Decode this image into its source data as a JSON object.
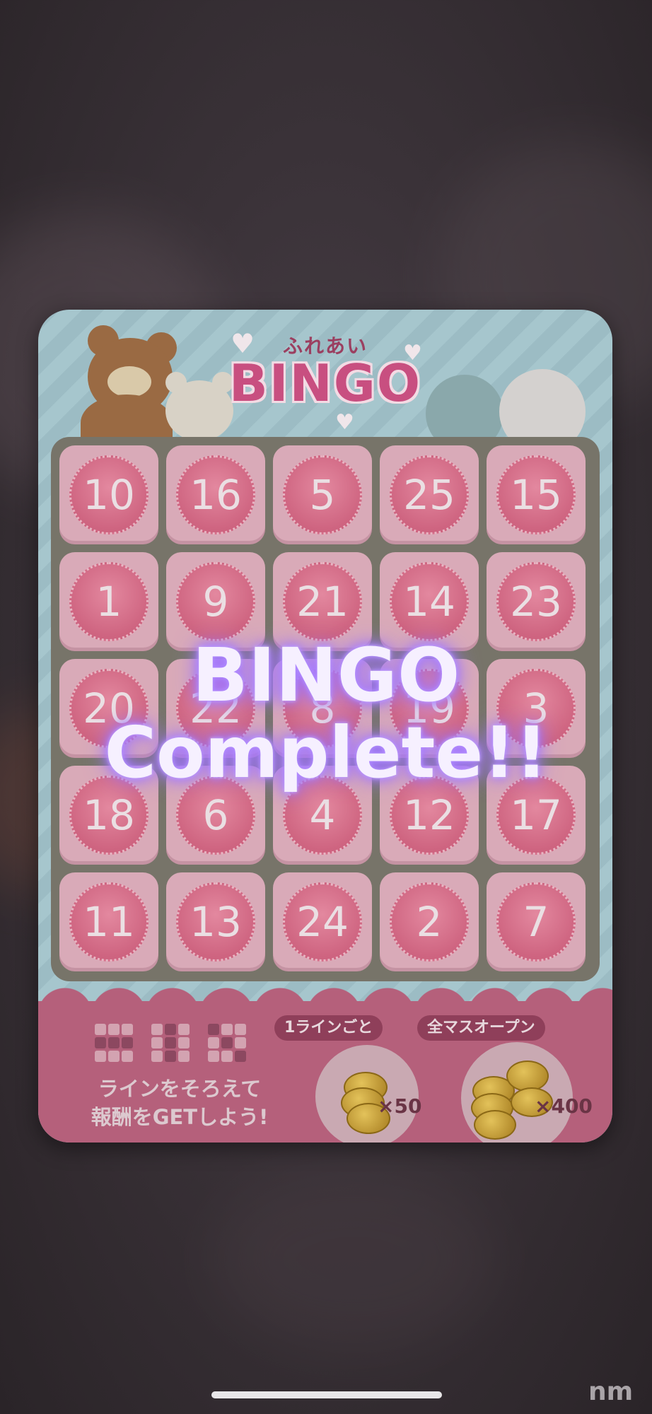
{
  "colors": {
    "backdrop": "#3a3238",
    "card_stripe": "#9cbcc4",
    "cell_bg": "#d9aab8",
    "stamp_pink": "#cf6581",
    "footer": "#b5607b",
    "overlay_glow": "#a27aff"
  },
  "header": {
    "subtitle": "ふれあい",
    "title": "BINGO"
  },
  "board": {
    "rows": [
      [
        "10",
        "16",
        "5",
        "25",
        "15"
      ],
      [
        "1",
        "9",
        "21",
        "14",
        "23"
      ],
      [
        "20",
        "22",
        "8",
        "19",
        "3"
      ],
      [
        "18",
        "6",
        "4",
        "12",
        "17"
      ],
      [
        "11",
        "13",
        "24",
        "2",
        "7"
      ]
    ]
  },
  "footer": {
    "hint_line1": "ラインをそろえて",
    "hint_line2": "報酬をGETしよう!",
    "reward_line_label": "1ラインごと",
    "reward_line_amount": "×50",
    "reward_full_label": "全マスオープン",
    "reward_full_amount": "×400"
  },
  "overlay": {
    "line1": "BINGO",
    "line2": "Complete!!"
  },
  "watermark": "nm"
}
